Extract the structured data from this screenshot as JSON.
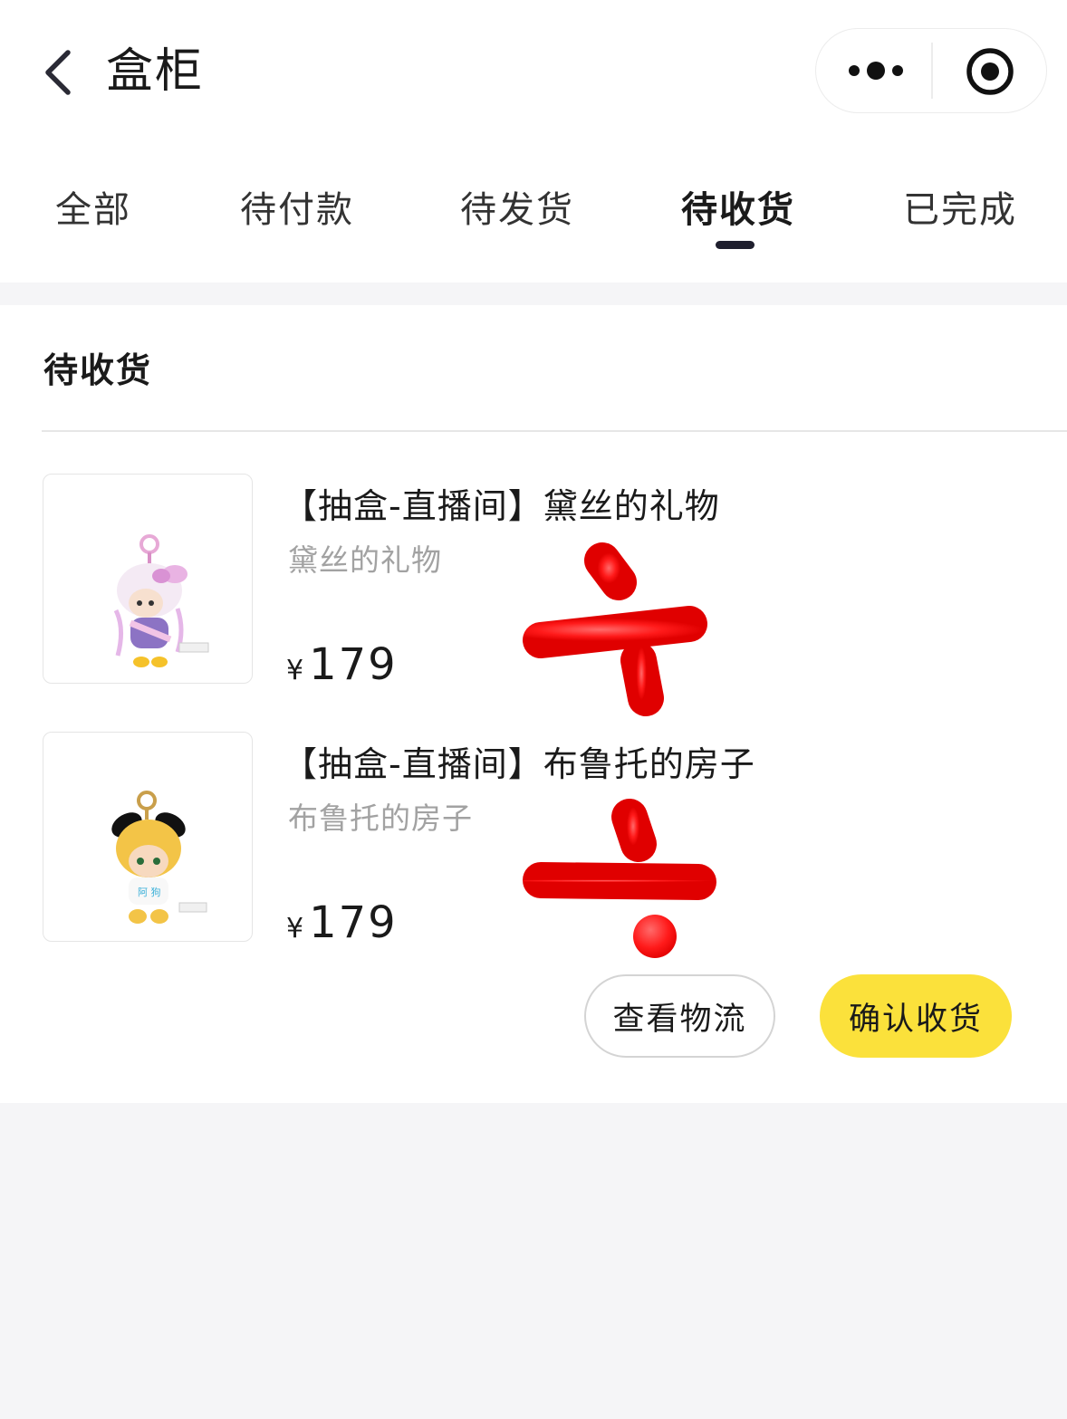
{
  "header": {
    "title": "盒柜",
    "icons": {
      "back": "chevron-left-icon",
      "more": "more-dots-icon",
      "close": "target-circle-icon"
    }
  },
  "tabs": [
    {
      "label": "全部",
      "active": false
    },
    {
      "label": "待付款",
      "active": false
    },
    {
      "label": "待发货",
      "active": false
    },
    {
      "label": "待收货",
      "active": true
    },
    {
      "label": "已完成",
      "active": false
    }
  ],
  "order": {
    "status_title": "待收货",
    "items": [
      {
        "name": "【抽盒-直播间】黛丝的礼物",
        "subtitle": "黛丝的礼物",
        "currency": "¥",
        "price": "179"
      },
      {
        "name": "【抽盒-直播间】布鲁托的房子",
        "subtitle": "布鲁托的房子",
        "currency": "¥",
        "price": "179"
      }
    ],
    "buttons": {
      "logistics": "查看物流",
      "confirm": "确认收货"
    }
  },
  "colors": {
    "accent_yellow": "#fbe13b",
    "annotation_red": "#ff1a1a",
    "page_background": "#f5f5f7"
  }
}
